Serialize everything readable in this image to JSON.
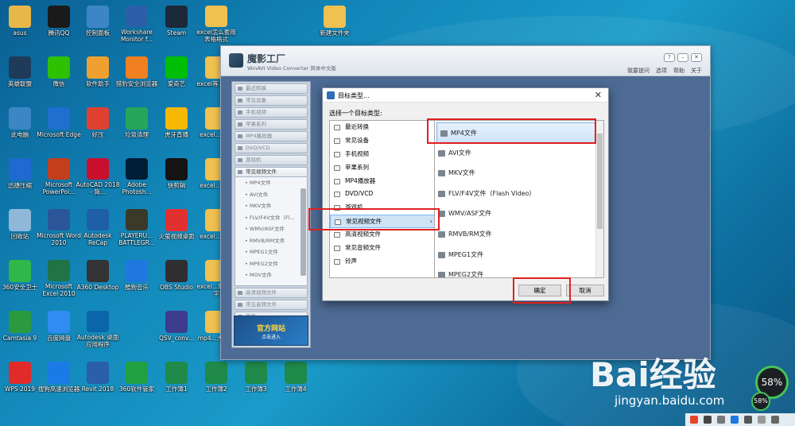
{
  "desktop_icons": [
    {
      "label": "asus",
      "color": "#e8b74a"
    },
    {
      "label": "腾讯QQ",
      "color": "#1a1a1a"
    },
    {
      "label": "控制面板",
      "color": "#3d86c6"
    },
    {
      "label": "Workshare Monitor f...",
      "color": "#2b5fa8"
    },
    {
      "label": "Steam",
      "color": "#1b2838"
    },
    {
      "label": "excel怎么套用表格格式",
      "color": "#f0c050"
    },
    {
      "label": "新建文件夹",
      "color": "#f0c050"
    },
    {
      "label": "英雄联盟",
      "color": "#1e3b5a"
    },
    {
      "label": "微信",
      "color": "#2dc100"
    },
    {
      "label": "软件助手",
      "color": "#f0a030"
    },
    {
      "label": "猎豹安全浏览器",
      "color": "#f08020"
    },
    {
      "label": "爱奇艺",
      "color": "#00be06"
    },
    {
      "label": "excel等...例完",
      "color": "#f0c050"
    },
    {
      "label": "此电脑",
      "color": "#3d86c6"
    },
    {
      "label": "Microsoft Edge",
      "color": "#1e6fcf"
    },
    {
      "label": "好压",
      "color": "#e04030"
    },
    {
      "label": "垃圾清理",
      "color": "#26a65b"
    },
    {
      "label": "虎牙直播",
      "color": "#f6b800"
    },
    {
      "label": "excel...生成",
      "color": "#f0c050"
    },
    {
      "label": "迅捷压缩",
      "color": "#1f6ad1"
    },
    {
      "label": "Microsoft PowerPoi...",
      "color": "#c43e1c"
    },
    {
      "label": "AutoCAD 2018 - 简...",
      "color": "#c8102e"
    },
    {
      "label": "Adobe Photosh...",
      "color": "#001e36"
    },
    {
      "label": "快剪辑",
      "color": "#141414"
    },
    {
      "label": "excel...成小",
      "color": "#f0c050"
    },
    {
      "label": "回收站",
      "color": "#8fb8d8"
    },
    {
      "label": "Microsoft Word 2010",
      "color": "#2b579a"
    },
    {
      "label": "Autodesk ReCap",
      "color": "#1f5fa8"
    },
    {
      "label": "PLAYERU... BATTLEGR...",
      "color": "#3a3a2a"
    },
    {
      "label": "火萤视频桌面",
      "color": "#e03030"
    },
    {
      "label": "excel...期算",
      "color": "#f0c050"
    },
    {
      "label": "360安全卫士",
      "color": "#2fb74a"
    },
    {
      "label": "Microsoft Excel 2010",
      "color": "#217346"
    },
    {
      "label": "A360 Desktop",
      "color": "#333333"
    },
    {
      "label": "酷狗音乐",
      "color": "#1e78e0"
    },
    {
      "label": "OBS Studio",
      "color": "#302e31"
    },
    {
      "label": "excel...取人名字",
      "color": "#f0c050"
    },
    {
      "label": "Camtasia 9",
      "color": "#2b9a3e"
    },
    {
      "label": "百度网盘",
      "color": "#2f8cf2"
    },
    {
      "label": "Autodesk 桌面应用程序",
      "color": "#0a66a8"
    },
    {
      "label": "QSV_conv...",
      "color": "#3c3c8c"
    },
    {
      "label": "mp4...大怎么",
      "color": "#f0c050"
    },
    {
      "label": "WPS 2019",
      "color": "#e22a2a"
    },
    {
      "label": "搜狗高速浏览器",
      "color": "#1a7be6"
    },
    {
      "label": "Revit 2018",
      "color": "#2b5fa8"
    },
    {
      "label": "360软件管家",
      "color": "#20a040"
    },
    {
      "label": "工作簿1",
      "color": "#1f8a4a"
    },
    {
      "label": "工作簿2",
      "color": "#1f8a4a"
    },
    {
      "label": "工作簿3",
      "color": "#1f8a4a"
    },
    {
      "label": "工作簿4",
      "color": "#1f8a4a"
    }
  ],
  "app": {
    "title": "魔影工厂",
    "subtitle": "WinAVI Video Converter 简体中文版",
    "menu": [
      "我要提问",
      "选项",
      "帮助",
      "关于"
    ],
    "nav": [
      "最近转换",
      "常见设备",
      "手机视频",
      "苹果系列",
      "MP4播放器",
      "DVD/VCD",
      "游戏机",
      "常见视频文件"
    ],
    "nav_sub": [
      "MP4文件",
      "AVI文件",
      "MKV文件",
      "FLV/F4V文件（Fl...",
      "WMV/ASF文件",
      "RMVB/RM文件",
      "MPEG1文件",
      "MPEG2文件",
      "MOV文件"
    ],
    "nav_bottom": [
      "高清视频文件",
      "常见音频文件",
      "铃声"
    ],
    "banner_title": "官方网站",
    "banner_sub": "点击进入"
  },
  "dialog": {
    "title": "目标类型...",
    "close": "✕",
    "prompt": "选择一个目标类型:",
    "categories": [
      "最近转换",
      "常见设备",
      "手机视频",
      "苹果系列",
      "MP4播放器",
      "DVD/VCD",
      "游戏机",
      "常见视频文件",
      "高清视频文件",
      "常见音频文件",
      "铃声"
    ],
    "selected_category": "常见视频文件",
    "formats": [
      "MP4文件",
      "AVI文件",
      "MKV文件",
      "FLV/F4V文件（Flash Video）",
      "WMV/ASF文件",
      "RMVB/RM文件",
      "MPEG1文件",
      "MPEG2文件"
    ],
    "selected_format": "MP4文件",
    "ok": "确定",
    "cancel": "取消"
  },
  "watermark": {
    "brand": "Bai经验",
    "url": "jingyan.baidu.com"
  },
  "meter": {
    "value": "58%",
    "small": "58%"
  },
  "colors": {
    "highlight": "#e02020",
    "accent": "#4d6b94"
  }
}
